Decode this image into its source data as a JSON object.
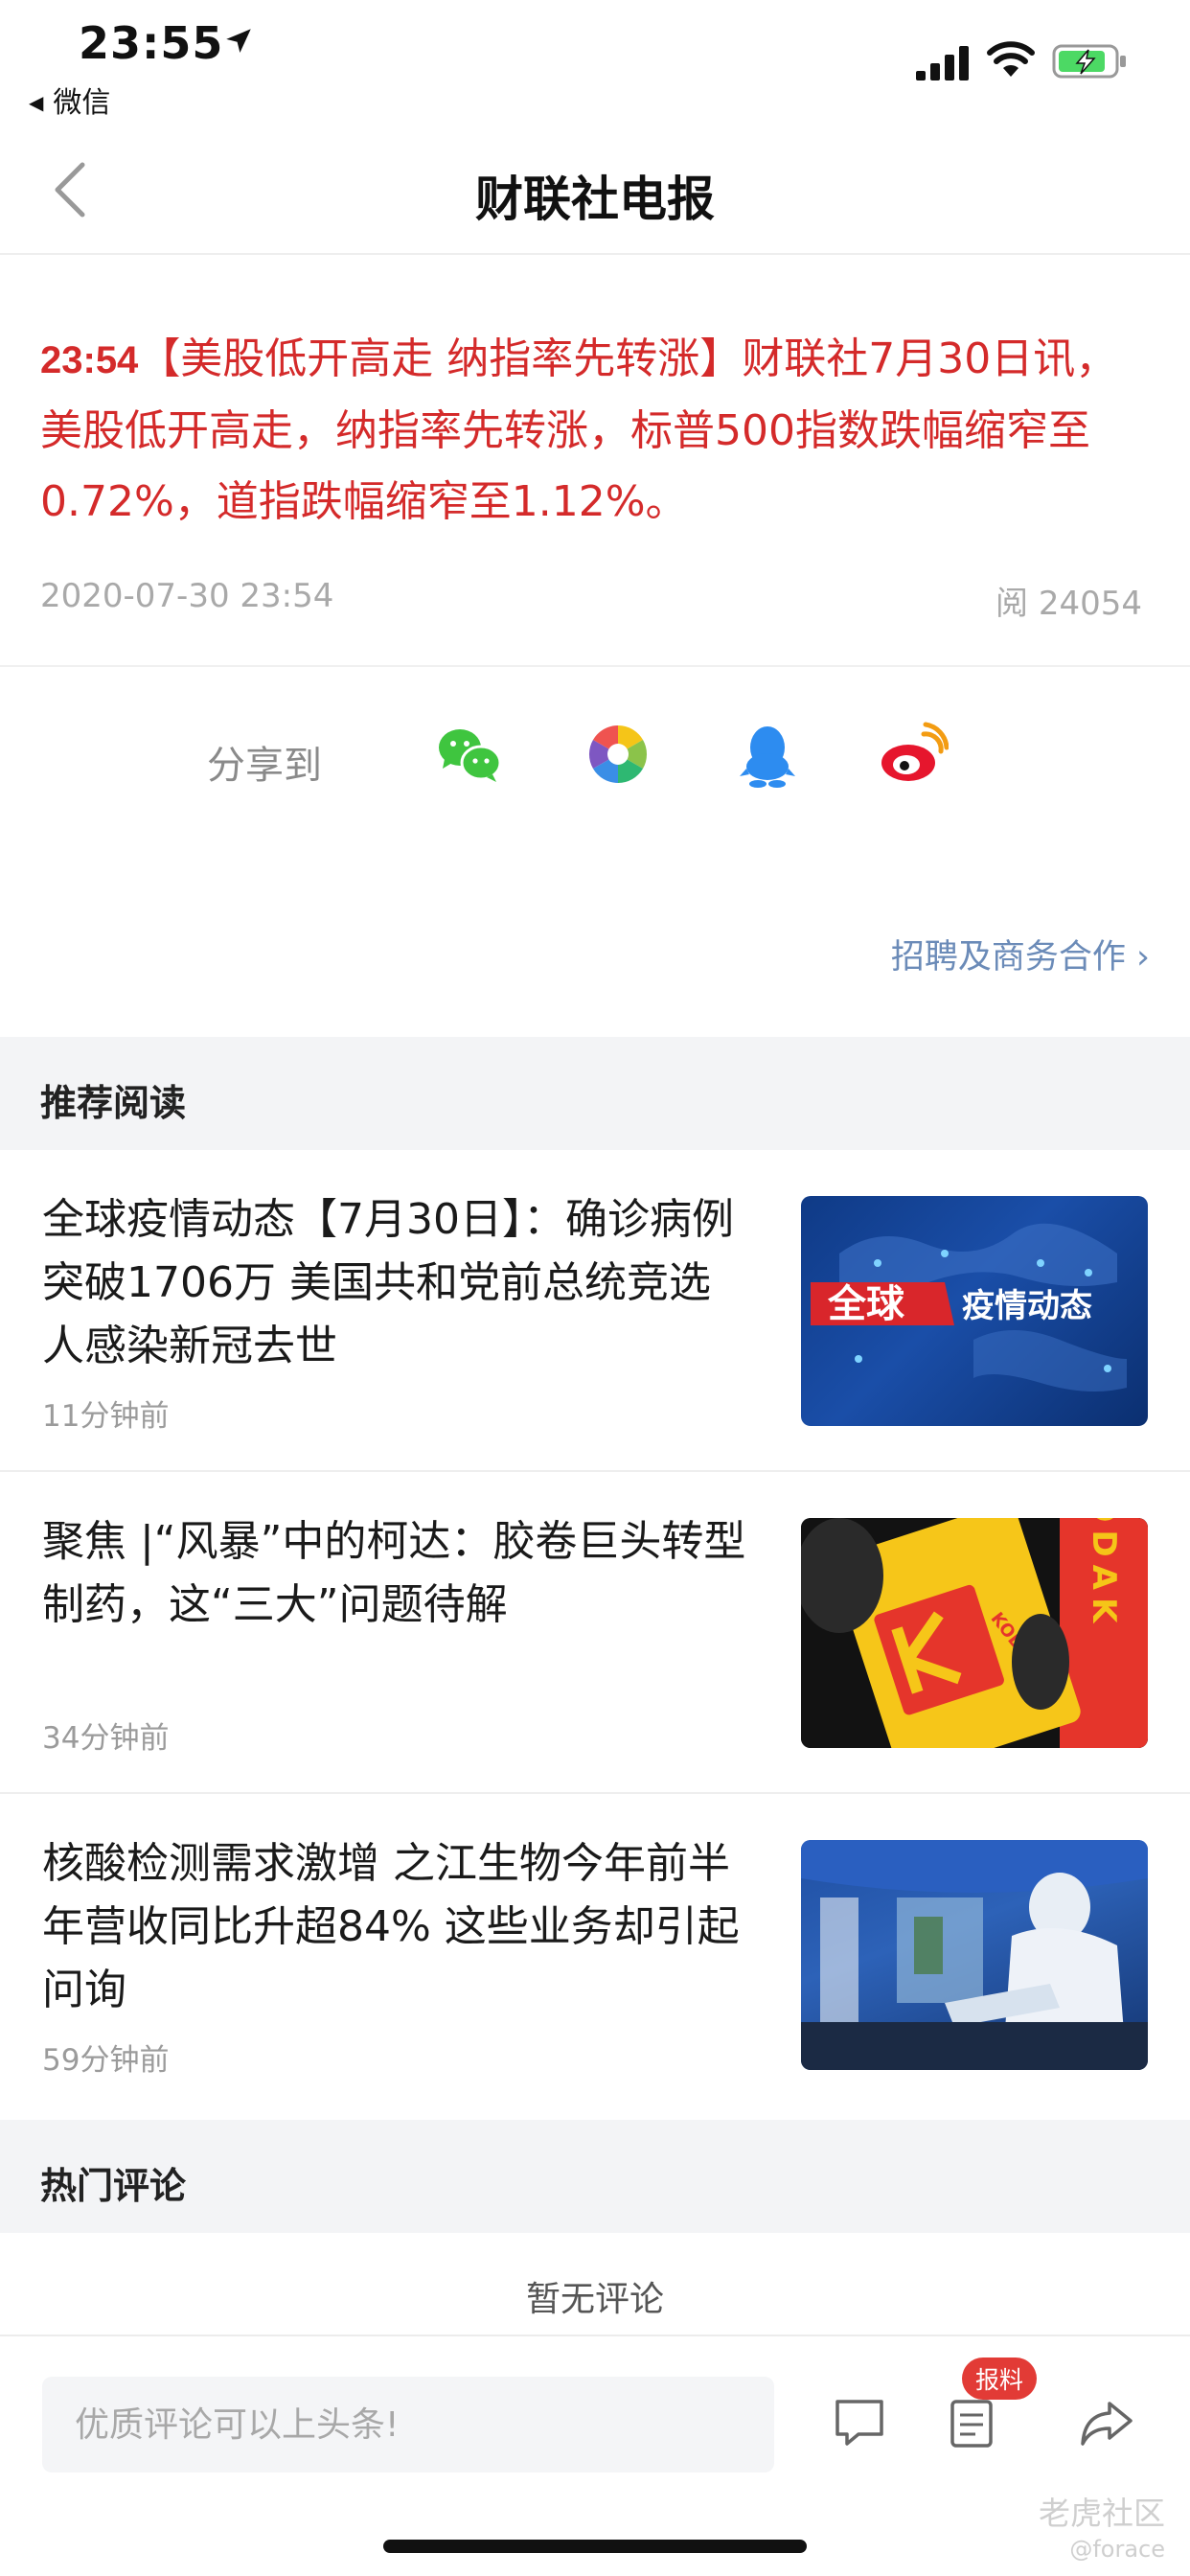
{
  "status_bar": {
    "time": "23:55",
    "back_app": "微信"
  },
  "nav": {
    "title": "财联社电报"
  },
  "article": {
    "time": "23:54",
    "headline": "【美股低开高走  纳指率先转涨】",
    "body": "财联社7月30日讯，美股低开高走，纳指率先转涨，标普500指数跌幅缩窄至0.72%，道指跌幅缩窄至1.12%。",
    "date": "2020-07-30 23:54",
    "reads": "阅 24054",
    "accent_color": "#d42a2a"
  },
  "share": {
    "label": "分享到",
    "icons": [
      "wechat-icon",
      "moments-icon",
      "qq-icon",
      "weibo-icon"
    ],
    "recruit_link": "招聘及商务合作 ›"
  },
  "recommended": {
    "header": "推荐阅读",
    "items": [
      {
        "title": "全球疫情动态【7月30日】：确诊病例突破1706万 美国共和党前总统竞选人感染新冠去世",
        "time": "11分钟前",
        "thumb_label_a": "全球",
        "thumb_label_b": "疫情动态"
      },
      {
        "title": "聚焦 |“风暴”中的柯达：胶卷巨头转型制药，这“三大”问题待解",
        "time": "34分钟前",
        "thumb_label_a": "KODAK",
        "thumb_label_b": "KODAK"
      },
      {
        "title": "核酸检测需求激增 之江生物今年前半年营收同比升超84% 这些业务却引起问询",
        "time": "59分钟前"
      }
    ]
  },
  "comments": {
    "header": "热门评论",
    "empty_text": "暂无评论"
  },
  "bottom_bar": {
    "input_placeholder": "优质评论可以上头条!",
    "badge": "报料",
    "watermark": "老虎社区",
    "watermark_sub": "@forace"
  }
}
